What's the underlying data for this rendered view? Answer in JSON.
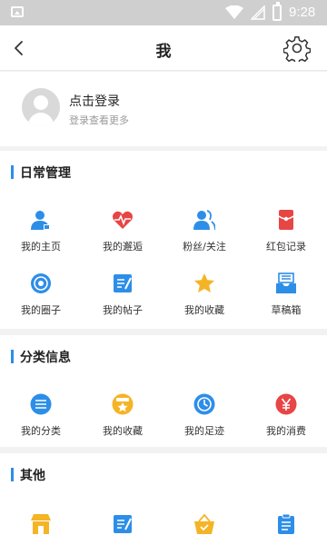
{
  "status_bar": {
    "time": "9:28"
  },
  "app_bar": {
    "title": "我"
  },
  "profile": {
    "login_label": "点击登录",
    "login_hint": "登录查看更多"
  },
  "sections": {
    "daily": {
      "title": "日常管理",
      "items": [
        {
          "label": "我的主页",
          "icon": "user-home-icon"
        },
        {
          "label": "我的邂逅",
          "icon": "heart-pulse-icon"
        },
        {
          "label": "粉丝/关注",
          "icon": "fans-icon"
        },
        {
          "label": "红包记录",
          "icon": "red-packet-icon"
        },
        {
          "label": "我的圈子",
          "icon": "circle-target-icon"
        },
        {
          "label": "我的帖子",
          "icon": "post-edit-icon"
        },
        {
          "label": "我的收藏",
          "icon": "star-icon"
        },
        {
          "label": "草稿箱",
          "icon": "draft-box-icon"
        }
      ]
    },
    "category": {
      "title": "分类信息",
      "items": [
        {
          "label": "我的分类",
          "icon": "category-list-icon"
        },
        {
          "label": "我的收藏",
          "icon": "favorite-star-icon"
        },
        {
          "label": "我的足迹",
          "icon": "clock-icon"
        },
        {
          "label": "我的消费",
          "icon": "yuan-icon"
        }
      ]
    },
    "other": {
      "title": "其他",
      "items": [
        {
          "label": "",
          "icon": "shop-icon"
        },
        {
          "label": "",
          "icon": "edit-icon"
        },
        {
          "label": "",
          "icon": "basket-icon"
        },
        {
          "label": "",
          "icon": "clipboard-icon"
        }
      ]
    }
  },
  "colors": {
    "accent": "#2d8ee8",
    "red": "#e84545",
    "gold": "#f5b425"
  }
}
